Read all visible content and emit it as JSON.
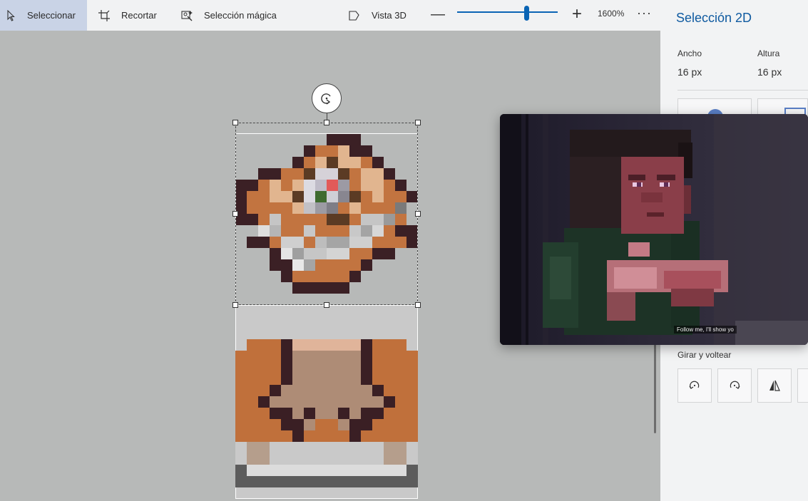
{
  "toolbar": {
    "select_label": "Seleccionar",
    "crop_label": "Recortar",
    "magic_select_label": "Selección mágica",
    "view3d_label": "Vista 3D",
    "zoom_value": "1600%",
    "zoom_slider_fraction": 0.7,
    "minus_glyph": "—",
    "plus_glyph": "+",
    "more_glyph": "···",
    "icons": [
      "select-cursor-icon",
      "crop-icon",
      "magic-select-icon",
      "view-3d-icon",
      "zoom-out-icon",
      "zoom-in-icon",
      "more-icon"
    ]
  },
  "panel": {
    "title": "Selección 2D",
    "width_label": "Ancho",
    "width_value": "16 px",
    "height_label": "Altura",
    "height_value": "16 px",
    "rotate_flip_label": "Girar y voltear",
    "icons": [
      "rotate-left-icon",
      "rotate-right-icon",
      "flip-horizontal-icon"
    ]
  },
  "video": {
    "subtitle": "Follow me, I'll show yo"
  },
  "colors": {
    "accent": "#0a64b4",
    "canvas_bg": "#b7b9b8",
    "toolbar_bg": "#f1f2f3",
    "selected_tool_bg": "#c9d3e6",
    "panel_title": "#0f5aa0"
  }
}
